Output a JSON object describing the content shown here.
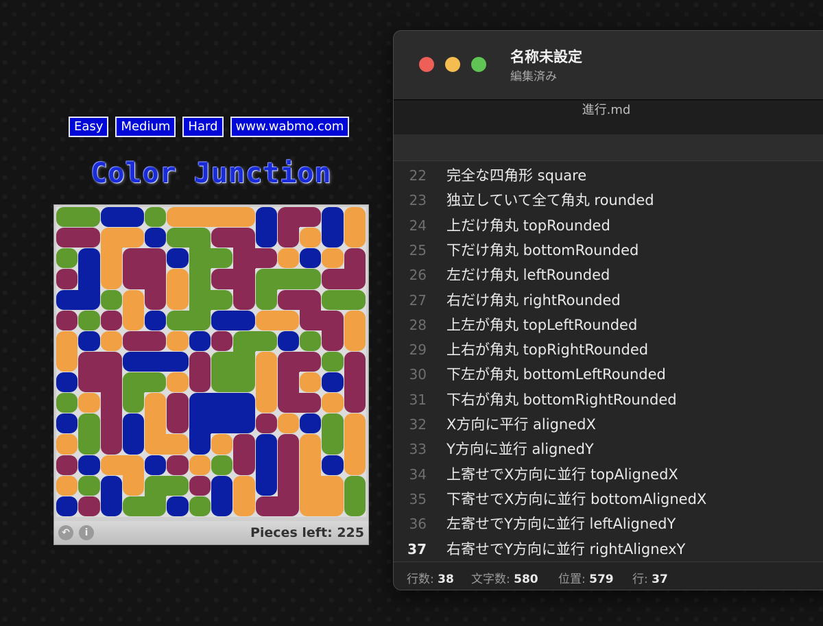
{
  "game": {
    "links": [
      "Easy",
      "Medium",
      "Hard",
      "www.wabmo.com"
    ],
    "title": "Color Junction",
    "pieces_left": "Pieces left: 225",
    "undo_icon": "undo-icon",
    "info_label": "i",
    "colors": {
      "G": "#5f9a2e",
      "B": "#0a1fa4",
      "M": "#8b2a55",
      "O": "#f1a043"
    },
    "grid": [
      "GGBBGOOOOBMMBO",
      "MMOOBGGMMBMOBO",
      "GBOMMBGGMMOBOM",
      "MBOMMOGMMGGGMM",
      "BBGOMOGGMGMMGG",
      "MGMOBGGBBOOMMO",
      "OBOMMOBMGGBGMO",
      "OMMBBBMGGOMMGM",
      "BMMGGOMGGOMOBM",
      "GOMGOMBBBOMMOM",
      "BGMBOMBBBMOBGO",
      "OGMBOOBOMBMOGO",
      "MBOOBMOGMBMOBO",
      "OGBOGGMBOBMOOG",
      "BMBGGBGBOMMOOG"
    ]
  },
  "editor": {
    "window_title": "名称未設定",
    "window_subtitle": "編集済み",
    "tab": "進行.md",
    "lines": [
      {
        "n": "22",
        "t": "完全な四角形 square"
      },
      {
        "n": "23",
        "t": "独立していて全て角丸 rounded"
      },
      {
        "n": "24",
        "t": "上だけ角丸 topRounded"
      },
      {
        "n": "25",
        "t": "下だけ角丸 bottomRounded"
      },
      {
        "n": "26",
        "t": "左だけ角丸 leftRounded"
      },
      {
        "n": "27",
        "t": "右だけ角丸 rightRounded"
      },
      {
        "n": "28",
        "t": "上左が角丸 topLeftRounded"
      },
      {
        "n": "29",
        "t": "上右が角丸 topRightRounded"
      },
      {
        "n": "30",
        "t": "下左が角丸 bottomLeftRounded"
      },
      {
        "n": "31",
        "t": "下右が角丸 bottomRightRounded"
      },
      {
        "n": "32",
        "t": "X方向に平行 alignedX"
      },
      {
        "n": "33",
        "t": "Y方向に並行 alignedY"
      },
      {
        "n": "34",
        "t": "上寄せでX方向に並行 topAlignedX"
      },
      {
        "n": "35",
        "t": "下寄せでX方向に並行 bottomAlignedX"
      },
      {
        "n": "36",
        "t": "左寄せでY方向に並行 leftAlignedY"
      },
      {
        "n": "37",
        "t": "右寄せでY方向に並行 rightAlignexY"
      }
    ],
    "current_line": "37",
    "status": {
      "lines_label": "行数:",
      "lines_value": "38",
      "chars_label": "文字数:",
      "chars_value": "580",
      "pos_label": "位置:",
      "pos_value": "579",
      "row_label": "行:",
      "row_value": "37"
    },
    "traffic_lights": {
      "close": "#ed5f57",
      "minimize": "#f5bd4f",
      "zoom": "#5fc453"
    }
  }
}
